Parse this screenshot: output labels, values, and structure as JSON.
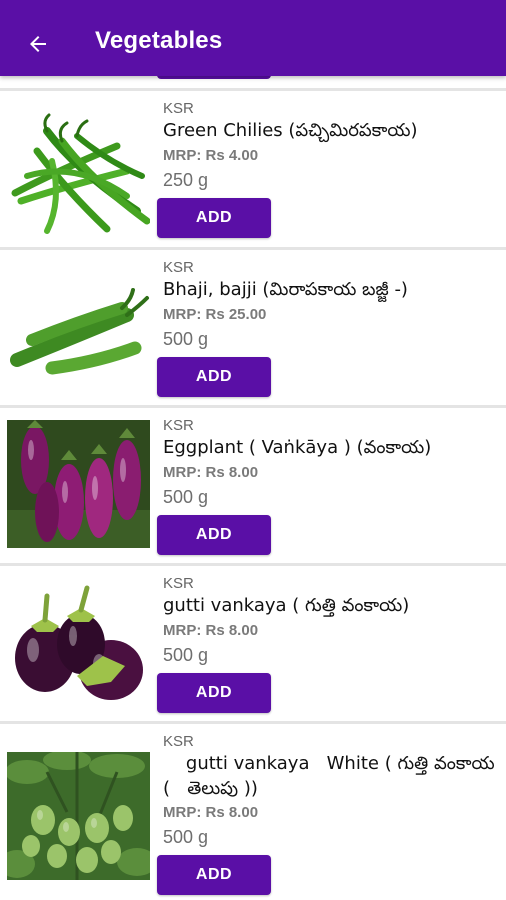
{
  "appbar": {
    "title": "Vegetables",
    "back_icon": "arrow-left-icon",
    "color": "#5a0fa6"
  },
  "products": [
    {
      "brand": "KSR",
      "name": "Green Chilies (పచ్చిమిరపకాయ)",
      "mrp": "MRP: Rs 4.00",
      "quantity": "250 g",
      "add_label": "ADD",
      "image": "green-chilies-image"
    },
    {
      "brand": "KSR",
      "name": "Bhaji, bajji (మిరాపకాయ బజ్జీ -)",
      "mrp": "MRP: Rs 25.00",
      "quantity": "500 g",
      "add_label": "ADD",
      "image": "bajji-chilies-image"
    },
    {
      "brand": "KSR",
      "name": "Eggplant  ( Vaṅkāya ) (వంకాయ)",
      "mrp": "MRP: Rs 8.00",
      "quantity": "500 g",
      "add_label": "ADD",
      "image": "eggplant-image"
    },
    {
      "brand": "KSR",
      "name": "gutti vankaya ( గుత్తి వంకాయ)",
      "mrp": "MRP: Rs 8.00",
      "quantity": "500 g",
      "add_label": "ADD",
      "image": "gutti-vankaya-image"
    },
    {
      "brand": "KSR",
      "name": "    gutti vankaya   White ( గుత్తి వంకాయ (   తెలుపు ))",
      "mrp": "MRP: Rs 8.00",
      "quantity": "500 g",
      "add_label": "ADD",
      "image": "white-brinjal-plant-image"
    }
  ]
}
